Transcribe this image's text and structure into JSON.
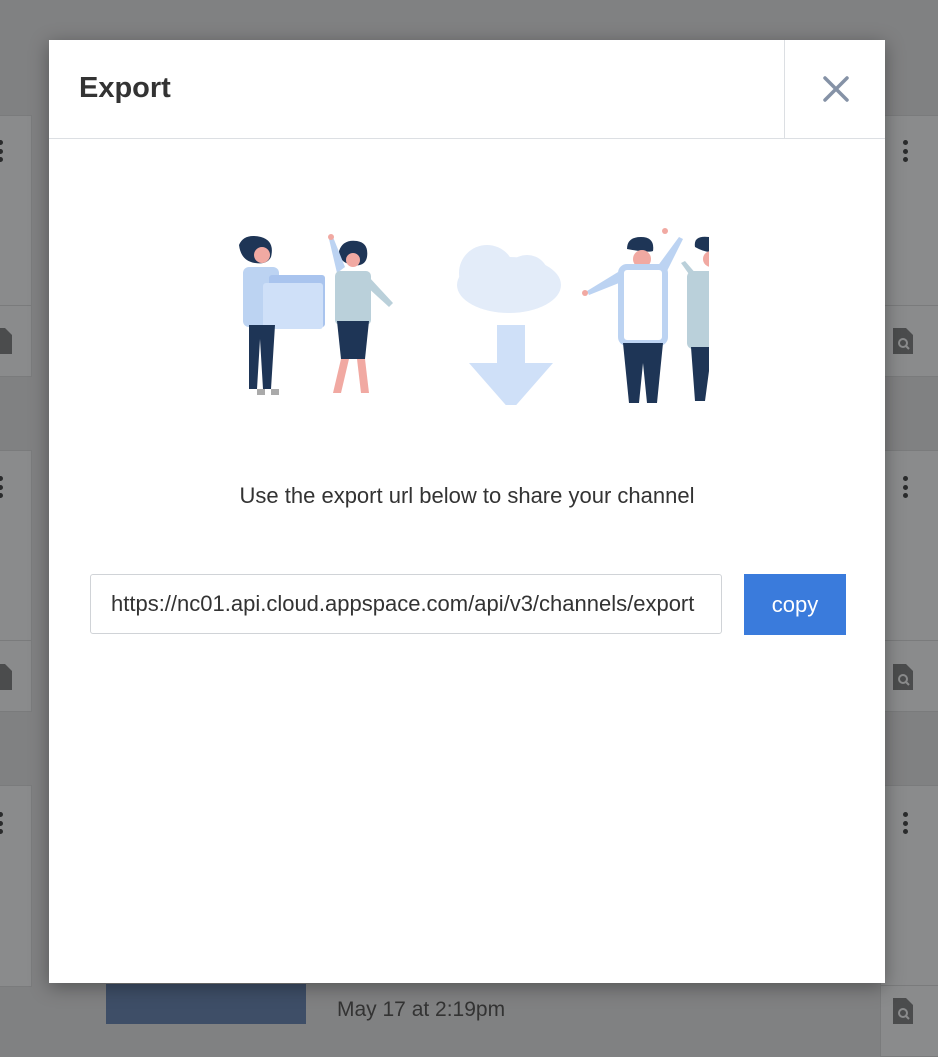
{
  "modal": {
    "title": "Export",
    "close_label": "close",
    "message": "Use the export url below to share your channel",
    "export_url": "https://nc01.api.cloud.appspace.com/api/v3/channels/export",
    "copy_label": "copy"
  },
  "background": {
    "timestamp": "May 17 at 2:19pm"
  },
  "colors": {
    "accent": "#3a7bdc",
    "overlay": "#808182",
    "title": "#333333"
  }
}
